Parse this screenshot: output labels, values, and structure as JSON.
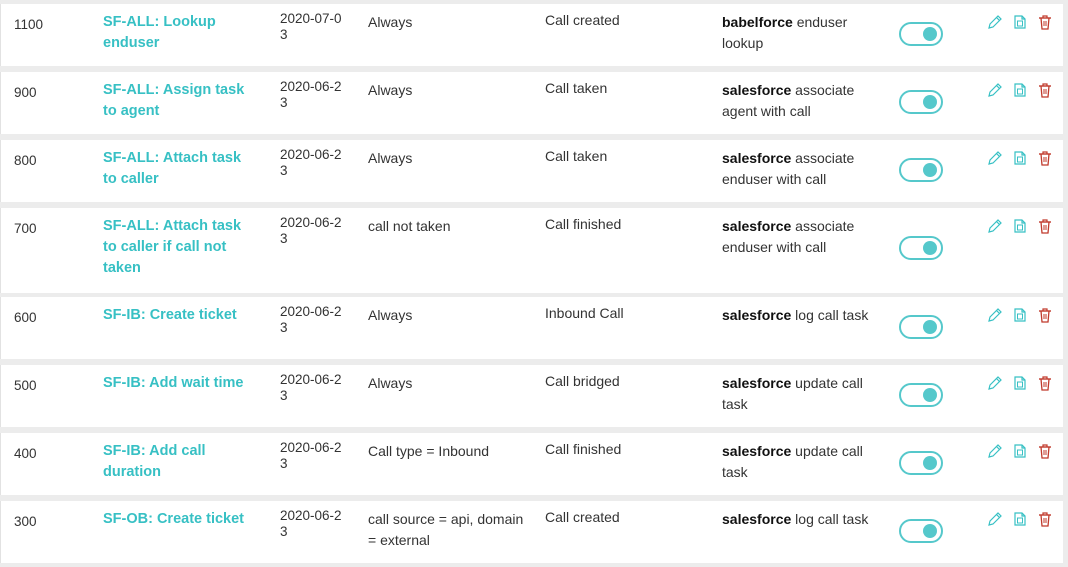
{
  "colors": {
    "accent": "#37c0c4",
    "toggle": "#55c8cb",
    "delete": "#c0392b",
    "edit": "#37c0c4",
    "copy": "#37c0c4"
  },
  "icons": {
    "edit": "pencil-icon",
    "copy": "copy-icon",
    "delete": "trash-icon"
  },
  "rows": [
    {
      "priority": "1100",
      "name": "SF-ALL: Lookup enduser",
      "date": "2020-07-03",
      "condition": "Always",
      "trigger": "Call created",
      "action_brand": "babelforce",
      "action_text": " enduser lookup",
      "enabled": true
    },
    {
      "priority": "900",
      "name": "SF-ALL: Assign task to agent",
      "date": "2020-06-23",
      "condition": "Always",
      "trigger": "Call taken",
      "action_brand": "salesforce",
      "action_text": " associate agent with call",
      "enabled": true
    },
    {
      "priority": "800",
      "name": "SF-ALL: Attach task to caller",
      "date": "2020-06-23",
      "condition": "Always",
      "trigger": "Call taken",
      "action_brand": "salesforce",
      "action_text": " associate enduser with call",
      "enabled": true
    },
    {
      "priority": "700",
      "name": "SF-ALL: Attach task to caller if call not taken",
      "date": "2020-06-23",
      "condition": "call not taken",
      "trigger": "Call finished",
      "action_brand": "salesforce",
      "action_text": " associate enduser with call",
      "enabled": true
    },
    {
      "priority": "600",
      "name": "SF-IB: Create ticket",
      "date": "2020-06-23",
      "condition": "Always",
      "trigger": "Inbound Call",
      "action_brand": "salesforce",
      "action_text": " log call task",
      "enabled": true
    },
    {
      "priority": "500",
      "name": "SF-IB: Add wait time",
      "date": "2020-06-23",
      "condition": "Always",
      "trigger": "Call bridged",
      "action_brand": "salesforce",
      "action_text": " update call task",
      "enabled": true
    },
    {
      "priority": "400",
      "name": "SF-IB: Add call duration",
      "date": "2020-06-23",
      "condition": "Call type = Inbound",
      "trigger": "Call finished",
      "action_brand": "salesforce",
      "action_text": " update call task",
      "enabled": true
    },
    {
      "priority": "300",
      "name": "SF-OB: Create ticket",
      "date": "2020-06-23",
      "condition": "call source = api, domain = external",
      "trigger": "Call created",
      "action_brand": "salesforce",
      "action_text": " log call task",
      "enabled": true
    }
  ]
}
